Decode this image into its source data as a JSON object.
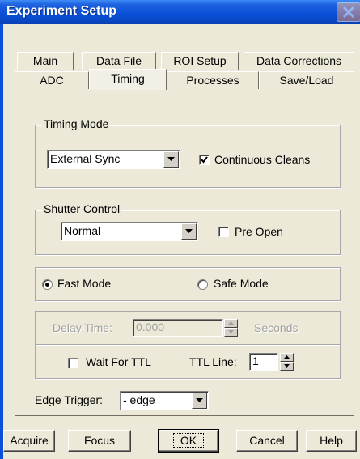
{
  "window": {
    "title": "Experiment Setup"
  },
  "tabs": {
    "row1": [
      "Main",
      "Data File",
      "ROI Setup",
      "Data Corrections"
    ],
    "row2": [
      "ADC",
      "Timing",
      "Processes",
      "Save/Load"
    ],
    "active": "Timing"
  },
  "timing_mode": {
    "group_label": "Timing Mode",
    "mode_value": "External Sync",
    "continuous_cleans_label": "Continuous Cleans",
    "continuous_cleans_checked": true
  },
  "shutter_control": {
    "group_label": "Shutter Control",
    "value": "Normal",
    "pre_open_label": "Pre Open",
    "pre_open_checked": false
  },
  "mode": {
    "fast_label": "Fast Mode",
    "safe_label": "Safe Mode",
    "selected": "Fast Mode"
  },
  "delay": {
    "label": "Delay Time:",
    "value": "0.000",
    "unit": "Seconds"
  },
  "ttl": {
    "wait_label": "Wait For TTL",
    "wait_checked": false,
    "line_label": "TTL Line:",
    "line_value": "1"
  },
  "edge_trigger": {
    "label": "Edge Trigger:",
    "value": "- edge"
  },
  "buttons": {
    "acquire": "Acquire",
    "focus": "Focus",
    "ok": "OK",
    "cancel": "Cancel",
    "help": "Help"
  },
  "colors": {
    "titlebar": "#0a50d8",
    "dialog_bg": "#ece9d8"
  }
}
